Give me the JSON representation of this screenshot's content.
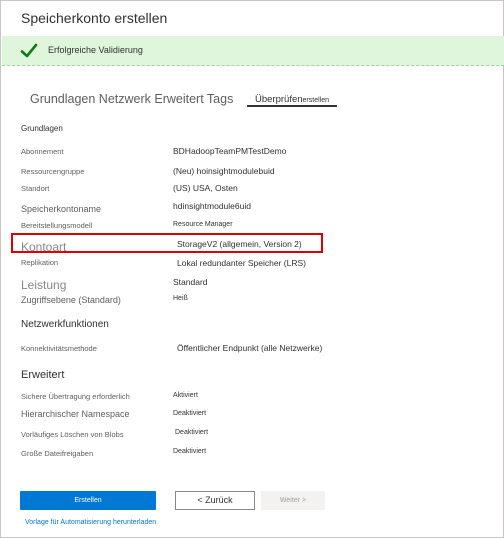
{
  "window": {
    "title": "Speicherkonto erstellen"
  },
  "banner": {
    "text": "Erfolgreiche Validierung",
    "color": "#dff6dd",
    "icon": "checkmark-icon"
  },
  "tabs": {
    "inactive_labels": "Grundlagen Netzwerk Erweitert Tags",
    "active_main": "Überprüfen",
    "active_sub": "erstellen"
  },
  "sections": {
    "grundlagen": "Grundlagen",
    "netzwerk": "Netzwerkfunktionen",
    "erweitert": "Erweitert"
  },
  "fields": {
    "abonnement": {
      "label": "Abonnement",
      "value": "BDHadoopTeamPMTestDemo"
    },
    "ressourcengruppe": {
      "label": "Ressourcengruppe",
      "value": "(Neu) hoinsightmodulebuid"
    },
    "standort": {
      "label": "Standort",
      "value": "(US) USA, Osten"
    },
    "speicherkontoname": {
      "label": "Speicherkontoname",
      "value": "hdinsightmodule6uid"
    },
    "bereitstellungsmodell": {
      "label": "Bereitstellungsmodell",
      "value": "Resource Manager"
    },
    "kontoart": {
      "label": "Kontoart",
      "value": "StorageV2 (allgemein, Version 2)"
    },
    "replikation": {
      "label": "Replikation",
      "value": "Lokal redundanter Speicher (LRS)"
    },
    "leistung": {
      "label": "Leistung",
      "value": "Standard"
    },
    "zugriffsebene": {
      "label": "Zugriffsebene (Standard)",
      "value": "Heiß"
    },
    "konnektivitaet": {
      "label": "Konnektivitätsmethode",
      "value": "Öffentlicher Endpunkt (alle Netzwerke)"
    },
    "sichere_uebertragung": {
      "label": "Sichere Übertragung erforderlich",
      "value": "Aktiviert"
    },
    "namespace": {
      "label": "Hierarchischer Namespace",
      "value": "Deaktiviert"
    },
    "loeschen": {
      "label": "Vorläufiges Löschen von Blobs",
      "value": "Deaktiviert"
    },
    "dateifreigaben": {
      "label": "Große Dateifreigaben",
      "value": "Deaktiviert"
    }
  },
  "footer": {
    "create_label": "Erstellen",
    "back_label": "< Zurück",
    "next_label": "Weiter >",
    "template_link": "Vorlage für Automatisierung herunterladen"
  }
}
